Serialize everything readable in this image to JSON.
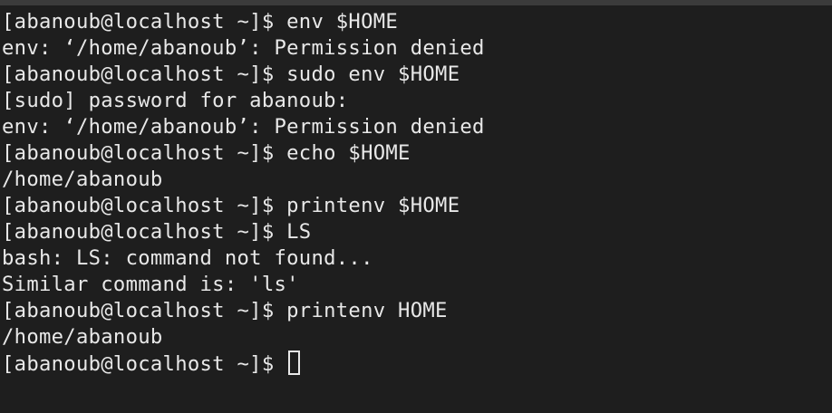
{
  "terminal": {
    "lines": [
      "[abanoub@localhost ~]$ env $HOME",
      "env: ‘/home/abanoub’: Permission denied",
      "[abanoub@localhost ~]$ sudo env $HOME",
      "[sudo] password for abanoub:",
      "env: ‘/home/abanoub’: Permission denied",
      "[abanoub@localhost ~]$ echo $HOME",
      "/home/abanoub",
      "[abanoub@localhost ~]$ printenv $HOME",
      "[abanoub@localhost ~]$ LS",
      "bash: LS: command not found...",
      "Similar command is: 'ls'",
      "[abanoub@localhost ~]$ printenv HOME",
      "/home/abanoub"
    ],
    "prompt": "[abanoub@localhost ~]$ "
  }
}
